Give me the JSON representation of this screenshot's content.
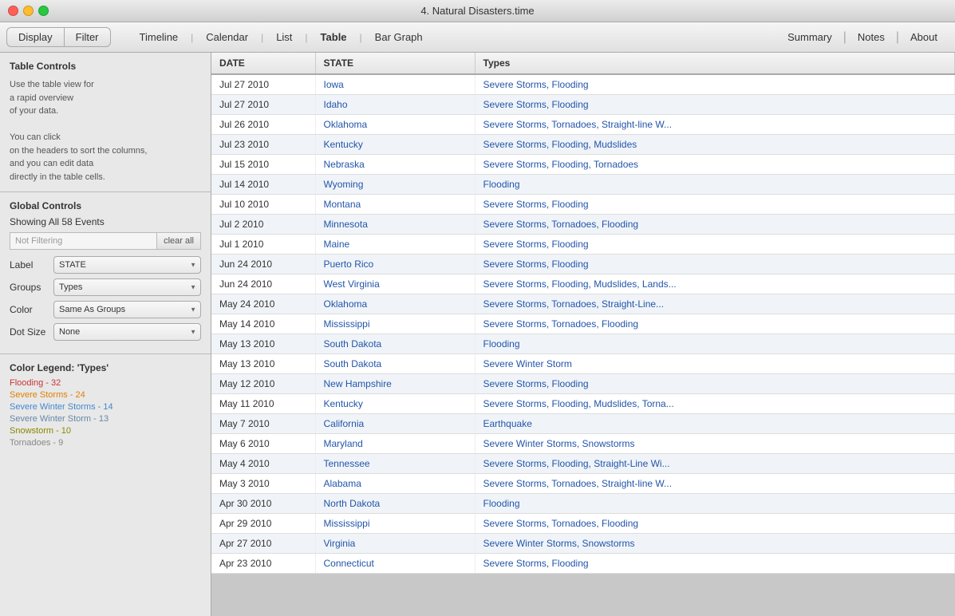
{
  "window": {
    "title": "4. Natural Disasters.time"
  },
  "toolbar_left": {
    "display": "Display",
    "filter": "Filter"
  },
  "view_tabs": {
    "timeline": "Timeline",
    "calendar": "Calendar",
    "list": "List",
    "table": "Table",
    "bar_graph": "Bar Graph"
  },
  "toolbar_right": {
    "summary": "Summary",
    "notes": "Notes",
    "about": "About"
  },
  "left_panel": {
    "table_controls_title": "Table Controls",
    "help_text": "Use the table view for\na rapid overview\nof your data.\n\nYou can click\non the headers to sort the columns,\nand you can edit data\ndirectly in the table cells.",
    "global_controls_title": "Global Controls",
    "showing_events": "Showing All 58 Events",
    "filter_placeholder": "Not Filtering",
    "clear_all": "clear all",
    "label_label": "Label",
    "label_value": "STATE",
    "groups_label": "Groups",
    "groups_value": "Types",
    "color_label": "Color",
    "color_value": "Same As Groups",
    "dot_size_label": "Dot Size",
    "dot_size_value": "None",
    "legend_title": "Color Legend: 'Types'",
    "legend_items": [
      {
        "label": "Flooding - 32",
        "color": "#cc3333",
        "class": "legend-flooding"
      },
      {
        "label": "Severe Storms - 24",
        "color": "#e08000",
        "class": "legend-severe-storms"
      },
      {
        "label": "Severe Winter Storms - 14",
        "color": "#4488cc",
        "class": "legend-severe-winter-storms"
      },
      {
        "label": "Severe Winter Storm - 13",
        "color": "#6688aa",
        "class": "legend-severe-winter-storm"
      },
      {
        "label": "Snowstorm - 10",
        "color": "#888800",
        "class": "legend-snowstorm"
      },
      {
        "label": "Tornadoes - 9",
        "color": "#888888",
        "class": "legend-tornadoes"
      }
    ]
  },
  "table": {
    "headers": [
      "DATE",
      "STATE",
      "Types"
    ],
    "rows": [
      {
        "date": "Jul 27 2010",
        "state": "Iowa",
        "types": "Severe Storms, Flooding"
      },
      {
        "date": "Jul 27 2010",
        "state": "Idaho",
        "types": "Severe Storms, Flooding"
      },
      {
        "date": "Jul 26 2010",
        "state": "Oklahoma",
        "types": "Severe Storms, Tornadoes, Straight-line W..."
      },
      {
        "date": "Jul 23 2010",
        "state": "Kentucky",
        "types": "Severe Storms, Flooding, Mudslides"
      },
      {
        "date": "Jul 15 2010",
        "state": "Nebraska",
        "types": "Severe Storms, Flooding, Tornadoes"
      },
      {
        "date": "Jul 14 2010",
        "state": "Wyoming",
        "types": "Flooding"
      },
      {
        "date": "Jul 10 2010",
        "state": "Montana",
        "types": "Severe Storms, Flooding"
      },
      {
        "date": "Jul 2 2010",
        "state": "Minnesota",
        "types": "Severe Storms, Tornadoes, Flooding"
      },
      {
        "date": "Jul 1 2010",
        "state": "Maine",
        "types": "Severe Storms, Flooding"
      },
      {
        "date": "Jun 24 2010",
        "state": "Puerto Rico",
        "types": "Severe Storms, Flooding"
      },
      {
        "date": "Jun 24 2010",
        "state": "West Virginia",
        "types": "Severe Storms, Flooding, Mudslides, Lands..."
      },
      {
        "date": "May 24 2010",
        "state": "Oklahoma",
        "types": "Severe Storms, Tornadoes, Straight-Line..."
      },
      {
        "date": "May 14 2010",
        "state": "Mississippi",
        "types": "Severe Storms, Tornadoes, Flooding"
      },
      {
        "date": "May 13 2010",
        "state": "South Dakota",
        "types": "Flooding"
      },
      {
        "date": "May 13 2010",
        "state": "South Dakota",
        "types": "Severe Winter Storm"
      },
      {
        "date": "May 12 2010",
        "state": "New Hampshire",
        "types": "Severe Storms, Flooding"
      },
      {
        "date": "May 11 2010",
        "state": "Kentucky",
        "types": "Severe Storms, Flooding, Mudslides, Torna..."
      },
      {
        "date": "May 7 2010",
        "state": "California",
        "types": "Earthquake"
      },
      {
        "date": "May 6 2010",
        "state": "Maryland",
        "types": "Severe Winter Storms, Snowstorms"
      },
      {
        "date": "May 4 2010",
        "state": "Tennessee",
        "types": "Severe Storms, Flooding, Straight-Line Wi..."
      },
      {
        "date": "May 3 2010",
        "state": "Alabama",
        "types": "Severe Storms, Tornadoes, Straight-line W..."
      },
      {
        "date": "Apr 30 2010",
        "state": "North Dakota",
        "types": "Flooding"
      },
      {
        "date": "Apr 29 2010",
        "state": "Mississippi",
        "types": "Severe Storms, Tornadoes, Flooding"
      },
      {
        "date": "Apr 27 2010",
        "state": "Virginia",
        "types": "Severe Winter Storms, Snowstorms"
      },
      {
        "date": "Apr 23 2010",
        "state": "Connecticut",
        "types": "Severe Storms, Flooding"
      }
    ]
  }
}
